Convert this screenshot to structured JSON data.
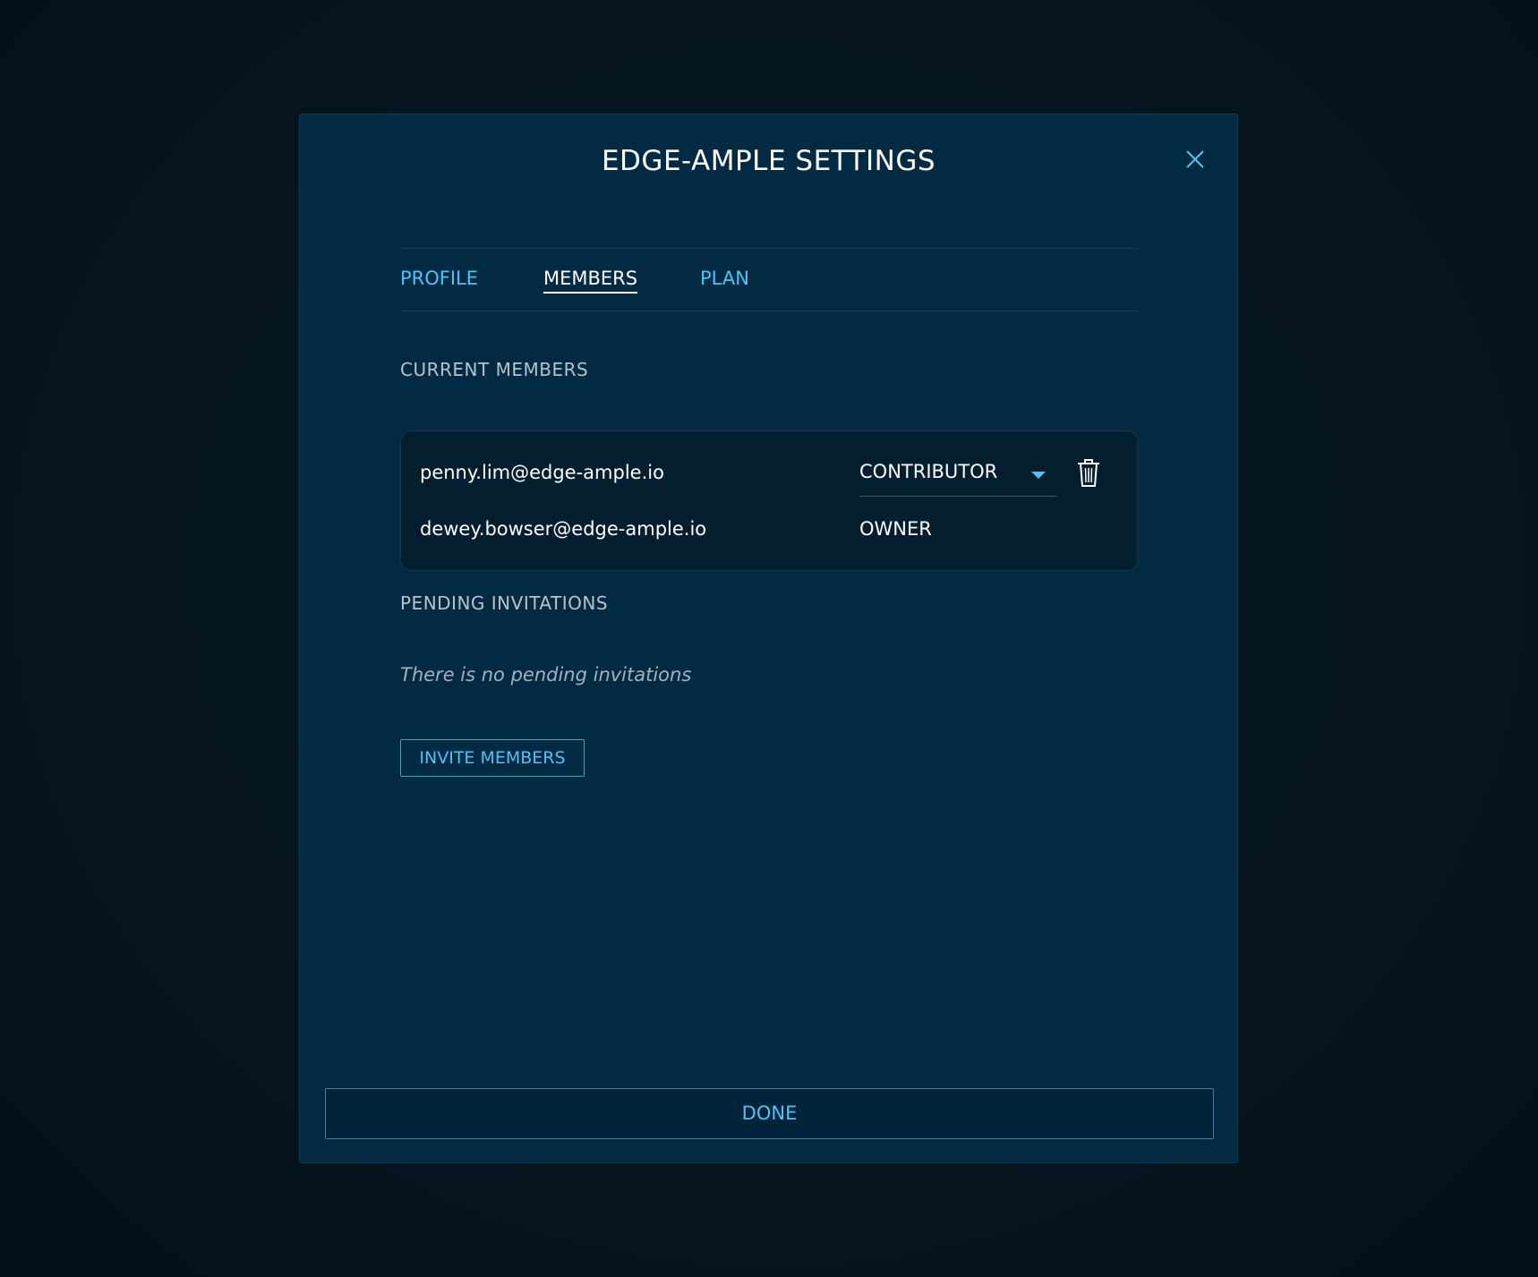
{
  "modal": {
    "title": "EDGE-AMPLE SETTINGS",
    "close_icon": "close-icon"
  },
  "tabs": [
    {
      "label": "PROFILE",
      "active": false
    },
    {
      "label": "MEMBERS",
      "active": true
    },
    {
      "label": "PLAN",
      "active": false
    }
  ],
  "current_members": {
    "heading": "CURRENT MEMBERS",
    "members": [
      {
        "email": "penny.lim@edge-ample.io",
        "role": "CONTRIBUTOR",
        "editable": true,
        "delete_icon": "trash-icon"
      },
      {
        "email": "dewey.bowser@edge-ample.io",
        "role": "OWNER",
        "editable": false
      }
    ]
  },
  "pending_invitations": {
    "heading": "PENDING INVITATIONS",
    "empty_text": "There is no pending invitations"
  },
  "invite_button": {
    "label": "INVITE MEMBERS"
  },
  "done_button": {
    "label": "DONE"
  },
  "colors": {
    "background": "#06151f",
    "modal": "#022b43",
    "accent": "#4fc3f7",
    "text": "#ffffff",
    "muted": "#b5c3cc"
  }
}
